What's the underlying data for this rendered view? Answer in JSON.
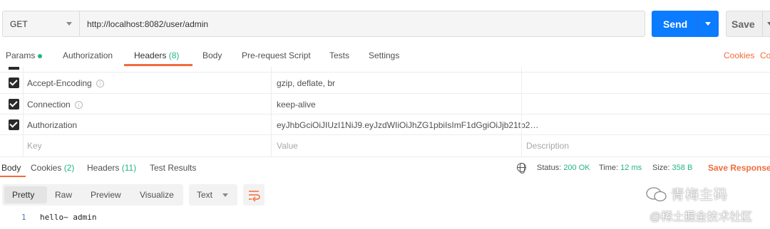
{
  "request": {
    "method": "GET",
    "url": "http://localhost:8082/user/admin",
    "send_label": "Send",
    "save_label": "Save"
  },
  "request_tabs": {
    "params": "Params",
    "authorization": "Authorization",
    "headers": "Headers",
    "headers_count": "(8)",
    "body": "Body",
    "prerequest": "Pre-request Script",
    "tests": "Tests",
    "settings": "Settings",
    "cookies": "Cookies",
    "code": "Co"
  },
  "headers_table": {
    "rows": [
      {
        "key": "Accept-Encoding",
        "value": "gzip, deflate, br",
        "checked": true
      },
      {
        "key": "Connection",
        "value": "keep-alive",
        "checked": true
      },
      {
        "key": "Authorization",
        "value": "eyJhbGciOiJIUzI1NiJ9.eyJzdWIiOiJhZG1pbiIsImF1dGgiOiJjb21tb2…",
        "checked": true
      }
    ],
    "placeholder_key": "Key",
    "placeholder_value": "Value",
    "placeholder_description": "Description",
    "info_glyph": "i"
  },
  "response_tabs": {
    "body": "Body",
    "cookies": "Cookies",
    "cookies_count": "(2)",
    "headers": "Headers",
    "headers_count": "(11)",
    "test_results": "Test Results"
  },
  "response_status": {
    "status_label": "Status:",
    "status_value": "200 OK",
    "time_label": "Time:",
    "time_value": "12 ms",
    "size_label": "Size:",
    "size_value": "358 B",
    "save_response": "Save Response"
  },
  "view_modes": {
    "pretty": "Pretty",
    "raw": "Raw",
    "preview": "Preview",
    "visualize": "Visualize",
    "format": "Text"
  },
  "response_body": {
    "lines": [
      {
        "number": "1",
        "text": "hello~ admin"
      }
    ]
  },
  "watermark": {
    "line1": "青梅主码",
    "line2": "@稀土掘金技术社区"
  },
  "colors": {
    "accent_orange": "#f26b3a",
    "send_blue": "#0b7bff",
    "status_green": "#26b47f"
  }
}
